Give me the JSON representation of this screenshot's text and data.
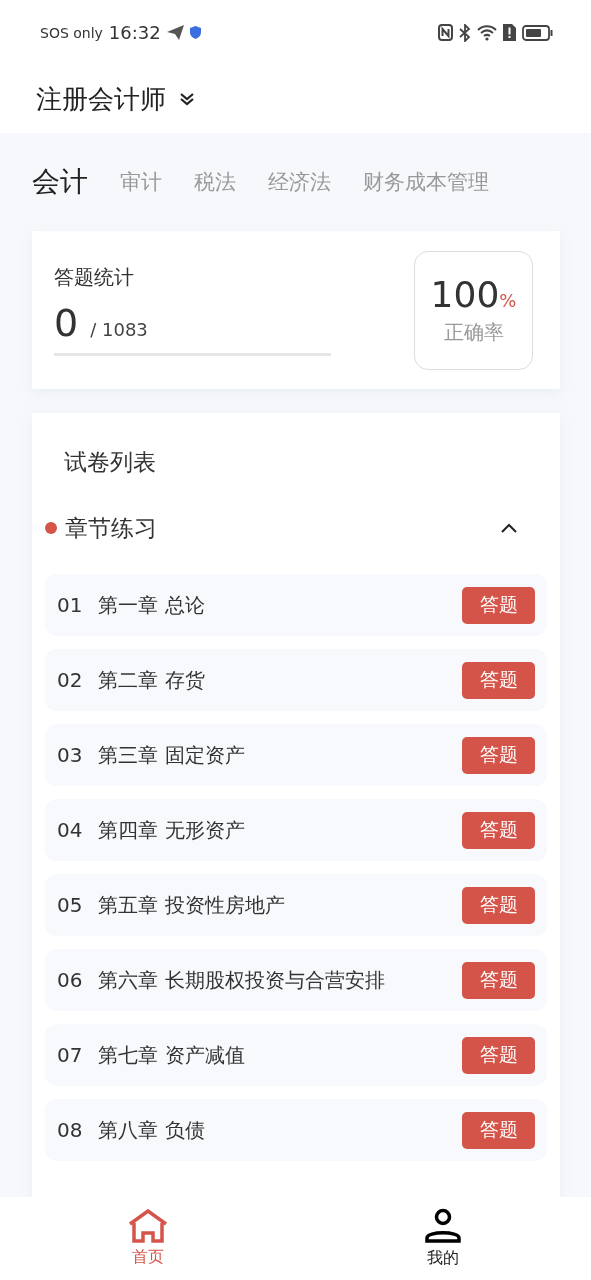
{
  "status_bar": {
    "carrier": "SOS only",
    "time": "16:32"
  },
  "header": {
    "title": "注册会计师"
  },
  "subject_tabs": [
    {
      "label": "会计",
      "selected": true
    },
    {
      "label": "审计",
      "selected": false
    },
    {
      "label": "税法",
      "selected": false
    },
    {
      "label": "经济法",
      "selected": false
    },
    {
      "label": "财务成本管理",
      "selected": false
    }
  ],
  "stats": {
    "title": "答题统计",
    "answered": "0",
    "total": "/ 1083",
    "accuracy": "100",
    "accuracy_unit": "%",
    "accuracy_label": "正确率"
  },
  "exam_list": {
    "title": "试卷列表",
    "section": {
      "title": "章节练习",
      "expanded": true
    },
    "items": [
      {
        "number": "01",
        "name": "第一章 总论",
        "action": "答题"
      },
      {
        "number": "02",
        "name": "第二章 存货",
        "action": "答题"
      },
      {
        "number": "03",
        "name": "第三章 固定资产",
        "action": "答题"
      },
      {
        "number": "04",
        "name": "第四章 无形资产",
        "action": "答题"
      },
      {
        "number": "05",
        "name": "第五章 投资性房地产",
        "action": "答题"
      },
      {
        "number": "06",
        "name": "第六章 长期股权投资与合营安排",
        "action": "答题"
      },
      {
        "number": "07",
        "name": "第七章 资产减值",
        "action": "答题"
      },
      {
        "number": "08",
        "name": "第八章 负债",
        "action": "答题"
      }
    ]
  },
  "bottom_nav": [
    {
      "label": "首页",
      "kind": "home",
      "selected": true
    },
    {
      "label": "我的",
      "kind": "profile",
      "selected": false
    }
  ]
}
